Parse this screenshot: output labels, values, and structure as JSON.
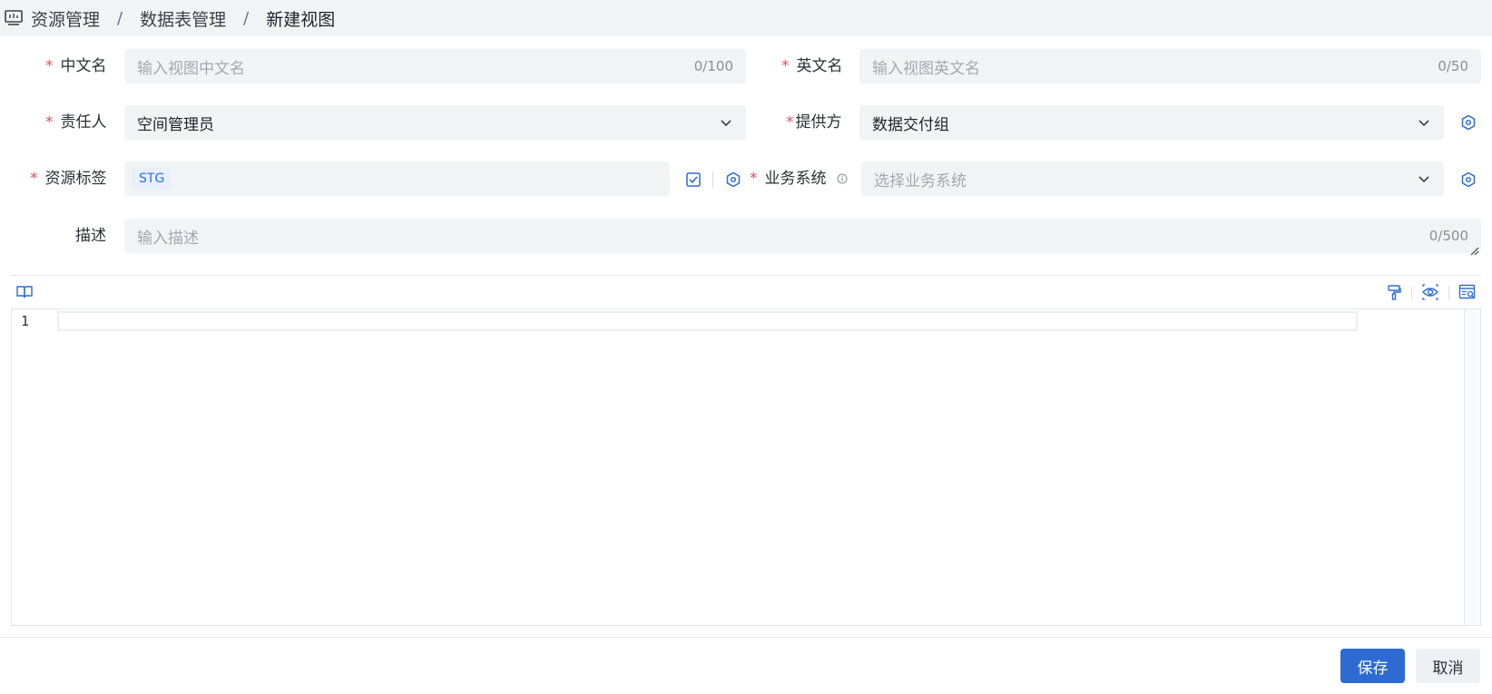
{
  "breadcrumb": {
    "items": [
      "资源管理",
      "新建视图"
    ],
    "middle": "数据表管理",
    "separator": "/"
  },
  "form": {
    "cn_name": {
      "label": "中文名",
      "placeholder": "输入视图中文名",
      "counter": "0/100"
    },
    "en_name": {
      "label": "英文名",
      "placeholder": "输入视图英文名",
      "counter": "0/50"
    },
    "owner": {
      "label": "责任人",
      "value": "空间管理员"
    },
    "provider": {
      "label": "提供方",
      "value": "数据交付组"
    },
    "resource_tag": {
      "label": "资源标签",
      "tag": "STG"
    },
    "business_system": {
      "label": "业务系统",
      "placeholder": "选择业务系统"
    },
    "description": {
      "label": "描述",
      "placeholder": "输入描述",
      "counter": "0/500"
    },
    "required_mark": "*"
  },
  "editor": {
    "line_number": "1"
  },
  "footer": {
    "save_label": "保存",
    "cancel_label": "取消"
  },
  "colors": {
    "accent": "#2d6bd3",
    "required": "#e34d59",
    "field_bg": "#f2f3f5"
  },
  "icons": {
    "home": "monitor-icon",
    "settings": "hexagon-settings-icon",
    "checkbox": "checkbox-icon",
    "docs": "book-icon",
    "format": "paint-brush-icon",
    "preview": "eye-icon",
    "search_table": "table-search-icon"
  }
}
